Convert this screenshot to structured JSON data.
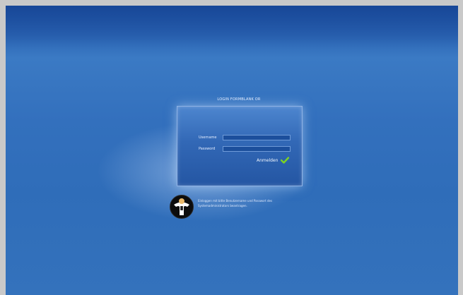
{
  "login": {
    "title": "LOGIN FORMBLANK OR",
    "username_label": "Username",
    "password_label": "Password",
    "username_value": "",
    "password_value": "",
    "submit_label": "Anmelden"
  },
  "footer": {
    "line1": "Einloggen mit bitte Benutzername und Passwort des",
    "line2": "Systemadministrators beantragen."
  },
  "colors": {
    "background": "#3370bd",
    "check": "#7ed321"
  },
  "icons": {
    "submit": "check-icon",
    "brand": "penguin-logo"
  }
}
